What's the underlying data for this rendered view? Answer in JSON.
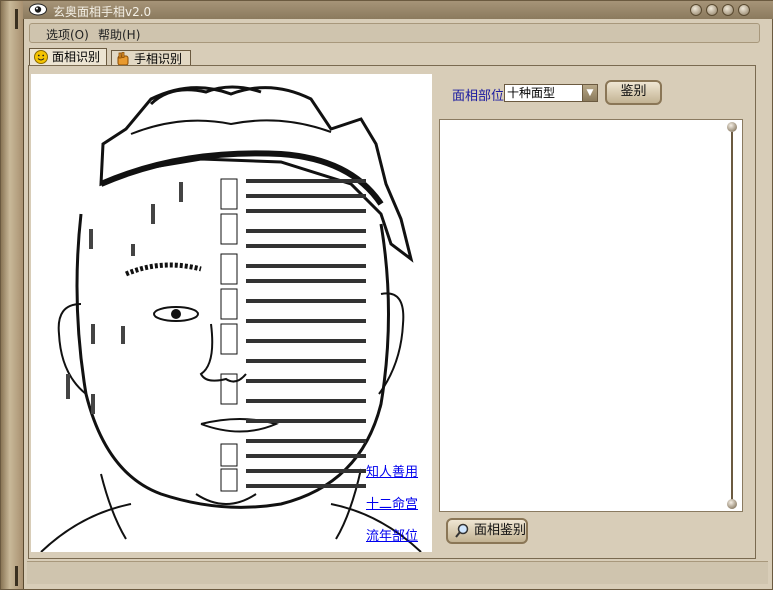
{
  "window": {
    "title": "玄奥面相手相v2.0"
  },
  "menu": {
    "items": [
      "选项(O)",
      "帮助(H)"
    ]
  },
  "tabs": [
    {
      "label": "面相识别",
      "icon": "smiley-icon"
    },
    {
      "label": "手相识别",
      "icon": "hand-icon"
    }
  ],
  "face_panel": {
    "links": [
      "知人善用",
      "十二命宫",
      "流年部位"
    ]
  },
  "controls": {
    "part_label": "面相部位",
    "select_value": "十种面型",
    "identify_button": "鉴别",
    "face_identify_button": "面相鉴别"
  },
  "colors": {
    "frame": "#d8cdb8",
    "accent_link": "#0000ee",
    "label": "#1a1aa0"
  }
}
